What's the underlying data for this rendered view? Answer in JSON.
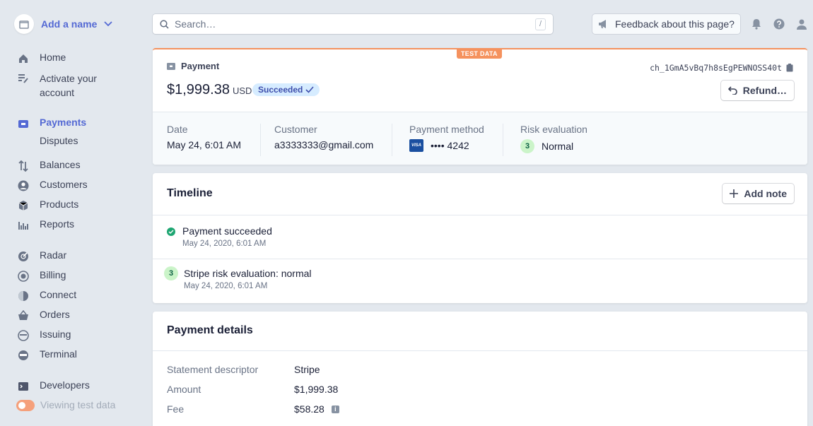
{
  "account": {
    "name": "Add a name"
  },
  "sidebar": {
    "items": [
      {
        "label": "Home",
        "icon": "home-icon"
      },
      {
        "label": "Activate your",
        "label2": "account",
        "icon": "checklist-icon"
      },
      {
        "label": "Payments",
        "icon": "payments-icon",
        "active": true
      },
      {
        "label": "Disputes"
      },
      {
        "label": "Balances",
        "icon": "balances-icon"
      },
      {
        "label": "Customers",
        "icon": "customers-icon"
      },
      {
        "label": "Products",
        "icon": "products-icon"
      },
      {
        "label": "Reports",
        "icon": "reports-icon"
      },
      {
        "label": "Radar",
        "icon": "radar-icon"
      },
      {
        "label": "Billing",
        "icon": "billing-icon"
      },
      {
        "label": "Connect",
        "icon": "connect-icon"
      },
      {
        "label": "Orders",
        "icon": "orders-icon"
      },
      {
        "label": "Issuing",
        "icon": "issuing-icon"
      },
      {
        "label": "Terminal",
        "icon": "terminal-icon"
      },
      {
        "label": "Developers",
        "icon": "developers-icon"
      },
      {
        "label": "Viewing test data",
        "icon": "toggle-icon"
      }
    ]
  },
  "topbar": {
    "search_placeholder": "Search…",
    "search_shortcut": "/",
    "feedback_label": "Feedback about this page?"
  },
  "payment": {
    "test_badge": "TEST DATA",
    "section_label": "Payment",
    "amount": "$1,999.38",
    "currency": "USD",
    "status": "Succeeded",
    "charge_id": "ch_1GmA5vBq7h8sEgPEWNOSS40t",
    "refund_label": "Refund…",
    "summary": {
      "date_label": "Date",
      "date_value": "May 24, 6:01 AM",
      "customer_label": "Customer",
      "customer_value": "a3333333@gmail.com",
      "method_label": "Payment method",
      "method_value": "•••• 4242",
      "card_brand": "VISA",
      "risk_label": "Risk evaluation",
      "risk_score": "3",
      "risk_value": "Normal"
    }
  },
  "timeline": {
    "title": "Timeline",
    "add_note_label": "Add note",
    "events": [
      {
        "title": "Payment succeeded",
        "time": "May 24, 2020, 6:01 AM"
      },
      {
        "badge": "3",
        "title": "Stripe risk evaluation: normal",
        "time": "May 24, 2020, 6:01 AM"
      }
    ]
  },
  "details": {
    "title": "Payment details",
    "rows": [
      {
        "key": "Statement descriptor",
        "value": "Stripe"
      },
      {
        "key": "Amount",
        "value": "$1,999.38"
      },
      {
        "key": "Fee",
        "value": "$58.28"
      }
    ]
  },
  "colors": {
    "accent": "#5469d4",
    "test": "#f5925e",
    "success": "#1ea672"
  }
}
